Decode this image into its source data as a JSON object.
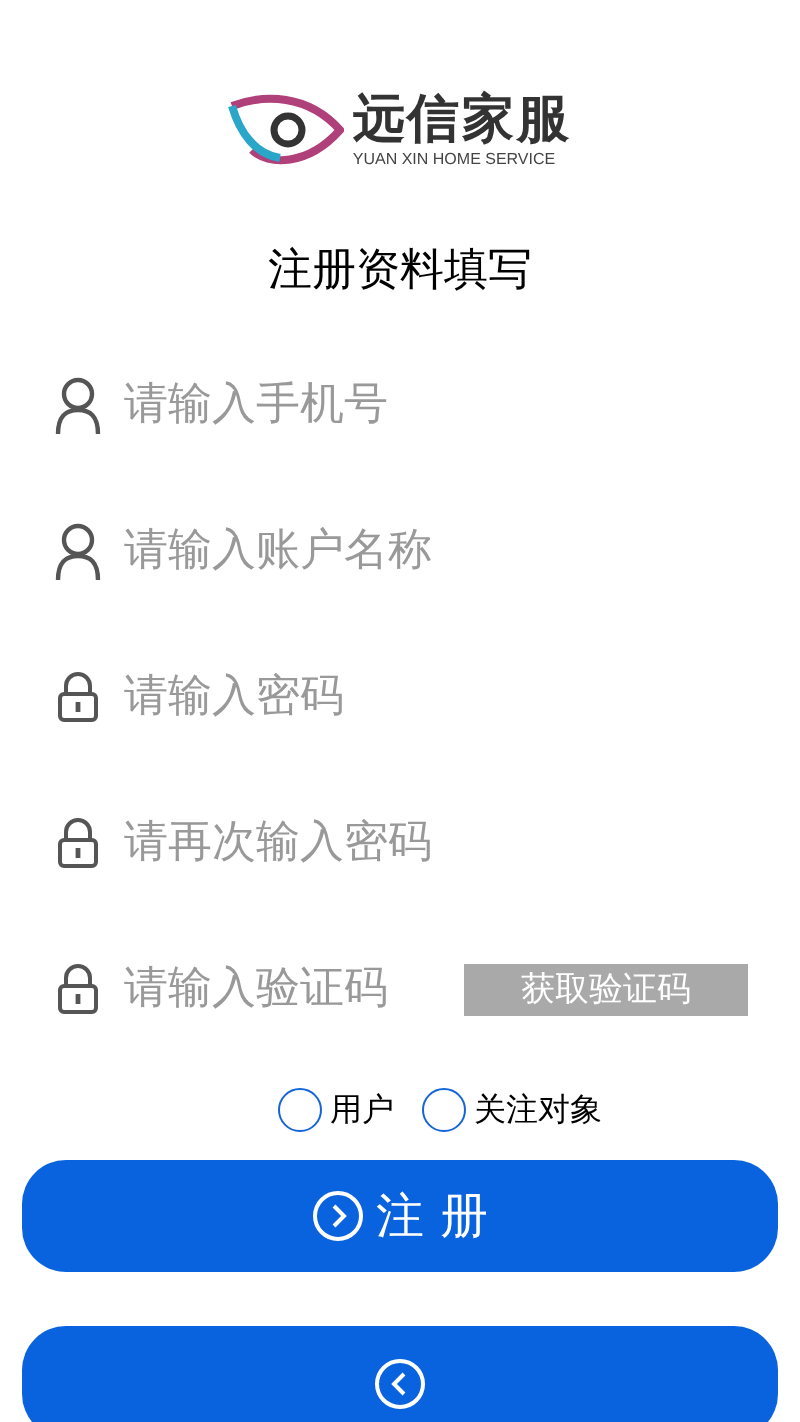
{
  "logo": {
    "name": "远信家服",
    "subtitle": "YUAN XIN HOME SERVICE"
  },
  "title": "注册资料填写",
  "fields": [
    {
      "kind": "user",
      "placeholder": "请输入手机号"
    },
    {
      "kind": "user",
      "placeholder": "请输入账户名称"
    },
    {
      "kind": "lock",
      "placeholder": "请输入密码"
    },
    {
      "kind": "lock",
      "placeholder": "请再次输入密码"
    },
    {
      "kind": "lock",
      "placeholder": "请输入验证码",
      "action": "获取验证码"
    }
  ],
  "roles": [
    {
      "label": "用户",
      "selected": false
    },
    {
      "label": "关注对象",
      "selected": false
    }
  ],
  "buttons": [
    {
      "kind": "register",
      "label": "注 册"
    },
    {
      "kind": "back"
    }
  ]
}
